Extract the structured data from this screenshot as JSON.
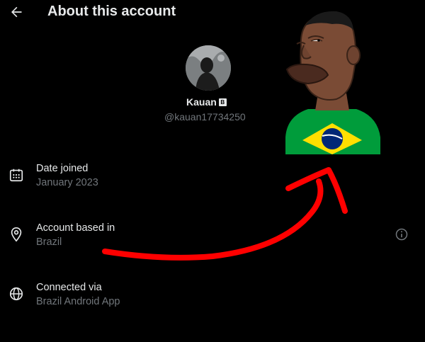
{
  "header": {
    "title": "About this account",
    "back_icon": "arrow-left-icon"
  },
  "profile": {
    "display_name": "Kauan",
    "badge": "🇧",
    "handle": "@kauan17734250"
  },
  "details": [
    {
      "label": "Date joined",
      "value": "January 2023",
      "icon": "calendar-icon"
    },
    {
      "label": "Account based in",
      "value": "Brazil",
      "icon": "location-pin-icon"
    },
    {
      "label": "Connected via",
      "value": "Brazil Android App",
      "icon": "globe-icon"
    }
  ],
  "colors": {
    "background": "#000000",
    "primary_text": "#e7e9ea",
    "secondary_text": "#71767b",
    "scribble": "#ff0000",
    "flag_green": "#009c3b",
    "flag_yellow": "#ffdf00",
    "flag_blue": "#002776"
  }
}
